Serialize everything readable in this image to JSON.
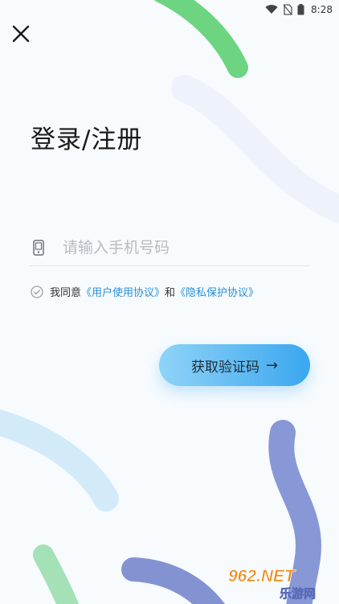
{
  "status_bar": {
    "time": "8:28"
  },
  "page": {
    "title": "登录/注册"
  },
  "phone": {
    "placeholder": "请输入手机号码",
    "value": ""
  },
  "agreement": {
    "prefix": "我同意",
    "user_agreement": "《用户使用协议》",
    "conjunction": "和",
    "privacy_agreement": "《隐私保护协议》",
    "checked": false
  },
  "cta": {
    "label": "获取验证码",
    "arrow": "→"
  },
  "watermark": {
    "brand": "962.NET",
    "site": "乐游网"
  },
  "colors": {
    "background": "#f7fbfe",
    "accent": "#2a8fd6",
    "button_start": "#8fd3f7",
    "button_end": "#3aa7ef",
    "deco_green": "#63d27a",
    "deco_purple": "#8a9ad6",
    "deco_blue": "#cde9f8"
  }
}
